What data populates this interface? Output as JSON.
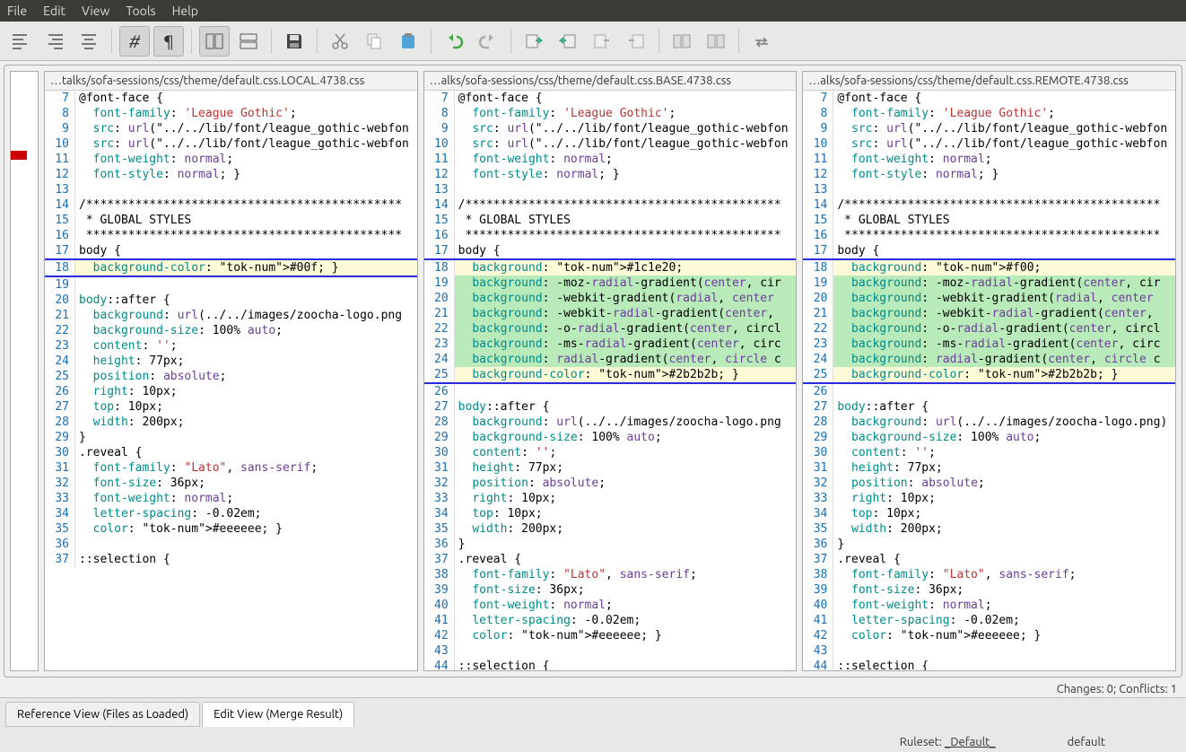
{
  "menu": {
    "items": [
      "File",
      "Edit",
      "View",
      "Tools",
      "Help"
    ]
  },
  "panes": [
    {
      "title": "…talks/sofa-sessions/css/theme/default.css.LOCAL.4738.css",
      "lines": [
        {
          "n": 7,
          "t": "@font-face {",
          "cls": ""
        },
        {
          "n": 8,
          "t": "  font-family: 'League Gothic';",
          "cls": ""
        },
        {
          "n": 9,
          "t": "  src: url(\"../../lib/font/league_gothic-webfon",
          "cls": ""
        },
        {
          "n": 10,
          "t": "  src: url(\"../../lib/font/league_gothic-webfon",
          "cls": ""
        },
        {
          "n": 11,
          "t": "  font-weight: normal;",
          "cls": ""
        },
        {
          "n": 12,
          "t": "  font-style: normal; }",
          "cls": ""
        },
        {
          "n": 13,
          "t": "",
          "cls": ""
        },
        {
          "n": 14,
          "t": "/*********************************************",
          "cls": ""
        },
        {
          "n": 15,
          "t": " * GLOBAL STYLES",
          "cls": ""
        },
        {
          "n": 16,
          "t": " *********************************************",
          "cls": ""
        },
        {
          "n": 17,
          "t": "body {",
          "cls": ""
        },
        {
          "n": 18,
          "t": "  background-color: #00f; }",
          "cls": "row-yellow conflict-top"
        },
        {
          "n": "",
          "t": "",
          "cls": "row-hatched"
        },
        {
          "n": "",
          "t": "",
          "cls": "row-hatched"
        },
        {
          "n": "",
          "t": "",
          "cls": "row-hatched"
        },
        {
          "n": "",
          "t": "",
          "cls": "row-hatched"
        },
        {
          "n": "",
          "t": "",
          "cls": "row-hatched"
        },
        {
          "n": "",
          "t": "",
          "cls": "row-hatched"
        },
        {
          "n": "",
          "t": "",
          "cls": "row-hatched conflict-bot"
        },
        {
          "n": 19,
          "t": "",
          "cls": ""
        },
        {
          "n": 20,
          "t": "body::after {",
          "cls": ""
        },
        {
          "n": 21,
          "t": "  background: url(../../images/zoocha-logo.png",
          "cls": ""
        },
        {
          "n": 22,
          "t": "  background-size: 100% auto;",
          "cls": ""
        },
        {
          "n": 23,
          "t": "  content: '';",
          "cls": ""
        },
        {
          "n": 24,
          "t": "  height: 77px;",
          "cls": ""
        },
        {
          "n": 25,
          "t": "  position: absolute;",
          "cls": ""
        },
        {
          "n": 26,
          "t": "  right: 10px;",
          "cls": ""
        },
        {
          "n": 27,
          "t": "  top: 10px;",
          "cls": ""
        },
        {
          "n": 28,
          "t": "  width: 200px;",
          "cls": ""
        },
        {
          "n": 29,
          "t": "}",
          "cls": ""
        },
        {
          "n": 30,
          "t": ".reveal {",
          "cls": ""
        },
        {
          "n": 31,
          "t": "  font-family: \"Lato\", sans-serif;",
          "cls": ""
        },
        {
          "n": 32,
          "t": "  font-size: 36px;",
          "cls": ""
        },
        {
          "n": 33,
          "t": "  font-weight: normal;",
          "cls": ""
        },
        {
          "n": 34,
          "t": "  letter-spacing: -0.02em;",
          "cls": ""
        },
        {
          "n": 35,
          "t": "  color: #eeeeee; }",
          "cls": ""
        },
        {
          "n": 36,
          "t": "",
          "cls": ""
        },
        {
          "n": 37,
          "t": "::selection {",
          "cls": ""
        }
      ]
    },
    {
      "title": "…alks/sofa-sessions/css/theme/default.css.BASE.4738.css",
      "lines": [
        {
          "n": 7,
          "t": "@font-face {",
          "cls": ""
        },
        {
          "n": 8,
          "t": "  font-family: 'League Gothic';",
          "cls": ""
        },
        {
          "n": 9,
          "t": "  src: url(\"../../lib/font/league_gothic-webfon",
          "cls": ""
        },
        {
          "n": 10,
          "t": "  src: url(\"../../lib/font/league_gothic-webfon",
          "cls": ""
        },
        {
          "n": 11,
          "t": "  font-weight: normal;",
          "cls": ""
        },
        {
          "n": 12,
          "t": "  font-style: normal; }",
          "cls": ""
        },
        {
          "n": 13,
          "t": "",
          "cls": ""
        },
        {
          "n": 14,
          "t": "/*********************************************",
          "cls": ""
        },
        {
          "n": 15,
          "t": " * GLOBAL STYLES",
          "cls": ""
        },
        {
          "n": 16,
          "t": " *********************************************",
          "cls": ""
        },
        {
          "n": 17,
          "t": "body {",
          "cls": ""
        },
        {
          "n": 18,
          "t": "  background: #1c1e20;",
          "cls": "row-yellow conflict-top"
        },
        {
          "n": 19,
          "t": "  background: -moz-radial-gradient(center, cir",
          "cls": "row-green"
        },
        {
          "n": 20,
          "t": "  background: -webkit-gradient(radial, center ",
          "cls": "row-green"
        },
        {
          "n": 21,
          "t": "  background: -webkit-radial-gradient(center, ",
          "cls": "row-green"
        },
        {
          "n": 22,
          "t": "  background: -o-radial-gradient(center, circl",
          "cls": "row-green"
        },
        {
          "n": 23,
          "t": "  background: -ms-radial-gradient(center, circ",
          "cls": "row-green"
        },
        {
          "n": 24,
          "t": "  background: radial-gradient(center, circle c",
          "cls": "row-green"
        },
        {
          "n": 25,
          "t": "  background-color: #2b2b2b; }",
          "cls": "row-yellow conflict-bot"
        },
        {
          "n": 26,
          "t": "",
          "cls": ""
        },
        {
          "n": 27,
          "t": "body::after {",
          "cls": ""
        },
        {
          "n": 28,
          "t": "  background: url(../../images/zoocha-logo.png",
          "cls": ""
        },
        {
          "n": 29,
          "t": "  background-size: 100% auto;",
          "cls": ""
        },
        {
          "n": 30,
          "t": "  content: '';",
          "cls": ""
        },
        {
          "n": 31,
          "t": "  height: 77px;",
          "cls": ""
        },
        {
          "n": 32,
          "t": "  position: absolute;",
          "cls": ""
        },
        {
          "n": 33,
          "t": "  right: 10px;",
          "cls": ""
        },
        {
          "n": 34,
          "t": "  top: 10px;",
          "cls": ""
        },
        {
          "n": 35,
          "t": "  width: 200px;",
          "cls": ""
        },
        {
          "n": 36,
          "t": "}",
          "cls": ""
        },
        {
          "n": 37,
          "t": ".reveal {",
          "cls": ""
        },
        {
          "n": 38,
          "t": "  font-family: \"Lato\", sans-serif;",
          "cls": ""
        },
        {
          "n": 39,
          "t": "  font-size: 36px;",
          "cls": ""
        },
        {
          "n": 40,
          "t": "  font-weight: normal;",
          "cls": ""
        },
        {
          "n": 41,
          "t": "  letter-spacing: -0.02em;",
          "cls": ""
        },
        {
          "n": 42,
          "t": "  color: #eeeeee; }",
          "cls": ""
        },
        {
          "n": 43,
          "t": "",
          "cls": ""
        },
        {
          "n": 44,
          "t": "::selection {",
          "cls": ""
        }
      ]
    },
    {
      "title": "…alks/sofa-sessions/css/theme/default.css.REMOTE.4738.css",
      "lines": [
        {
          "n": 7,
          "t": "@font-face {",
          "cls": ""
        },
        {
          "n": 8,
          "t": "  font-family: 'League Gothic';",
          "cls": ""
        },
        {
          "n": 9,
          "t": "  src: url(\"../../lib/font/league_gothic-webfon",
          "cls": ""
        },
        {
          "n": 10,
          "t": "  src: url(\"../../lib/font/league_gothic-webfon",
          "cls": ""
        },
        {
          "n": 11,
          "t": "  font-weight: normal;",
          "cls": ""
        },
        {
          "n": 12,
          "t": "  font-style: normal; }",
          "cls": ""
        },
        {
          "n": 13,
          "t": "",
          "cls": ""
        },
        {
          "n": 14,
          "t": "/*********************************************",
          "cls": ""
        },
        {
          "n": 15,
          "t": " * GLOBAL STYLES",
          "cls": ""
        },
        {
          "n": 16,
          "t": " *********************************************",
          "cls": ""
        },
        {
          "n": 17,
          "t": "body {",
          "cls": ""
        },
        {
          "n": 18,
          "t": "  background: #f00;",
          "cls": "row-yellow conflict-top"
        },
        {
          "n": 19,
          "t": "  background: -moz-radial-gradient(center, cir",
          "cls": "row-green"
        },
        {
          "n": 20,
          "t": "  background: -webkit-gradient(radial, center ",
          "cls": "row-green"
        },
        {
          "n": 21,
          "t": "  background: -webkit-radial-gradient(center, ",
          "cls": "row-green"
        },
        {
          "n": 22,
          "t": "  background: -o-radial-gradient(center, circl",
          "cls": "row-green"
        },
        {
          "n": 23,
          "t": "  background: -ms-radial-gradient(center, circ",
          "cls": "row-green"
        },
        {
          "n": 24,
          "t": "  background: radial-gradient(center, circle c",
          "cls": "row-green"
        },
        {
          "n": 25,
          "t": "  background-color: #2b2b2b; }",
          "cls": "row-yellow conflict-bot"
        },
        {
          "n": 26,
          "t": "",
          "cls": ""
        },
        {
          "n": 27,
          "t": "body::after {",
          "cls": ""
        },
        {
          "n": 28,
          "t": "  background: url(../../images/zoocha-logo.png)",
          "cls": ""
        },
        {
          "n": 29,
          "t": "  background-size: 100% auto;",
          "cls": ""
        },
        {
          "n": 30,
          "t": "  content: '';",
          "cls": ""
        },
        {
          "n": 31,
          "t": "  height: 77px;",
          "cls": ""
        },
        {
          "n": 32,
          "t": "  position: absolute;",
          "cls": ""
        },
        {
          "n": 33,
          "t": "  right: 10px;",
          "cls": ""
        },
        {
          "n": 34,
          "t": "  top: 10px;",
          "cls": ""
        },
        {
          "n": 35,
          "t": "  width: 200px;",
          "cls": ""
        },
        {
          "n": 36,
          "t": "}",
          "cls": ""
        },
        {
          "n": 37,
          "t": ".reveal {",
          "cls": ""
        },
        {
          "n": 38,
          "t": "  font-family: \"Lato\", sans-serif;",
          "cls": ""
        },
        {
          "n": 39,
          "t": "  font-size: 36px;",
          "cls": ""
        },
        {
          "n": 40,
          "t": "  font-weight: normal;",
          "cls": ""
        },
        {
          "n": 41,
          "t": "  letter-spacing: -0.02em;",
          "cls": ""
        },
        {
          "n": 42,
          "t": "  color: #eeeeee; }",
          "cls": ""
        },
        {
          "n": 43,
          "t": "",
          "cls": ""
        },
        {
          "n": 44,
          "t": "::selection {",
          "cls": ""
        }
      ]
    }
  ],
  "status": {
    "changes": "Changes: 0; Conflicts: 1"
  },
  "tabs": {
    "ref": "Reference View (Files as Loaded)",
    "edit": "Edit View (Merge Result)"
  },
  "statusbar": {
    "ruleset_label": "Ruleset:",
    "ruleset_value": "_Default_",
    "mode": "default"
  }
}
